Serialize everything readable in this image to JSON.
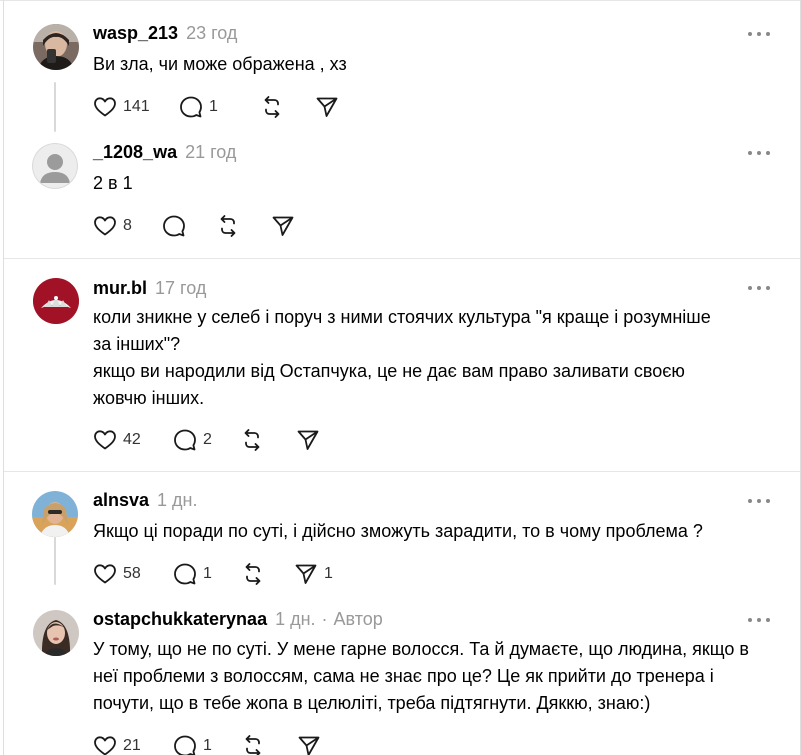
{
  "comments": [
    {
      "username": "wasp_213",
      "time": "23 год",
      "text": "Ви зла, чи може ображена , хз",
      "likes": "141",
      "replies": "1",
      "reposts": "",
      "shares": ""
    },
    {
      "username": "_1208_wa",
      "time": "21 год",
      "text": "2 в 1",
      "likes": "8",
      "replies": "",
      "reposts": "",
      "shares": ""
    },
    {
      "username": "mur.bl",
      "time": "17 год",
      "text": "коли зникне у селеб і поруч з ними стоячих культура \"я краще і розумніше\nза інших\"?\nякщо ви народили від Остапчука, це не дає вам право заливати своєю\nжовчю інших.",
      "likes": "42",
      "replies": "2",
      "reposts": "",
      "shares": ""
    },
    {
      "username": "alnsva",
      "time": "1 дн.",
      "text": "Якщо ці поради по суті, і дійсно зможуть зарадити, то в чому проблема ?",
      "likes": "58",
      "replies": "1",
      "reposts": "",
      "shares": "1"
    },
    {
      "username": "ostapchukkaterynaa",
      "time": "1 дн.",
      "separator": "·",
      "author_badge": "Автор",
      "text": "У тому, що не по суті. У мене гарне волосся. Та й думаєте, що людина, якщо в\nнеї проблеми з волоссям, сама не знає про це? Це як прийти до тренера і\nпочути, що в тебе жопа в целюліті, треба підтягнути. Дяккю, знаю:)",
      "likes": "21",
      "replies": "1",
      "reposts": "",
      "shares": ""
    }
  ],
  "icons": {
    "like": "heart-icon",
    "reply": "comment-bubble-icon",
    "repost": "repost-arrows-icon",
    "share": "send-icon",
    "more": "more-dots-icon"
  },
  "colors": {
    "text": "#000000",
    "muted": "#999999",
    "divider": "#e6e6e6",
    "icon": "#1a1a1a"
  }
}
